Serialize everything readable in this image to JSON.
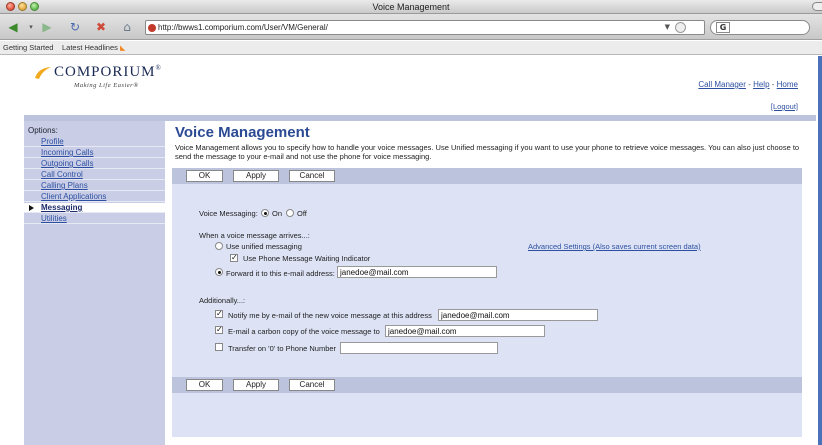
{
  "window": {
    "title": "Voice Management"
  },
  "browser": {
    "url": "http://bwws1.comporium.com/User/VM/General/",
    "bookmarks": [
      "Getting Started",
      "Latest Headlines"
    ]
  },
  "header": {
    "brand": "COMPORIUM",
    "brand_mark": "®",
    "tagline": "Making Life Easier®",
    "links": [
      "Call Manager",
      "Help",
      "Home"
    ],
    "link_separator": "-",
    "logout": "[Logout]"
  },
  "sidebar": {
    "heading": "Options:",
    "items": [
      {
        "label": "Profile"
      },
      {
        "label": "Incoming Calls"
      },
      {
        "label": "Outgoing Calls"
      },
      {
        "label": "Call Control"
      },
      {
        "label": "Calling Plans"
      },
      {
        "label": "Client Applications"
      },
      {
        "label": "Messaging",
        "active": true
      },
      {
        "label": "Utilities"
      }
    ]
  },
  "main": {
    "title": "Voice Management",
    "description": "Voice Management allows you to specify how to handle your voice messages. Use Unified messaging if you want to use your phone to retrieve voice messages. You can also just choose to send the message to your e-mail and not use the phone for voice messaging.",
    "buttons": {
      "ok": "OK",
      "apply": "Apply",
      "cancel": "Cancel"
    },
    "voice_messaging": {
      "label": "Voice Messaging:",
      "on": "On",
      "off": "Off",
      "selected": "On"
    },
    "when_arrives": {
      "label": "When a voice message arrives...:",
      "unified": "Use unified messaging",
      "mwi": "Use Phone Message Waiting Indicator",
      "mwi_checked": true,
      "forward": "Forward it to this e-mail address:",
      "forward_selected": true,
      "forward_email": "janedoe@mail.com",
      "advanced": "Advanced Settings (Also saves current screen data)"
    },
    "additionally": {
      "label": "Additionally...:",
      "notify": "Notify me by e-mail of the new voice message at this address",
      "notify_checked": true,
      "notify_email": "janedoe@mail.com",
      "carbon": "E-mail a carbon copy of the voice message to",
      "carbon_checked": true,
      "carbon_email": "janedoe@mail.com",
      "transfer": "Transfer on '0' to Phone Number",
      "transfer_checked": false,
      "transfer_number": ""
    }
  }
}
